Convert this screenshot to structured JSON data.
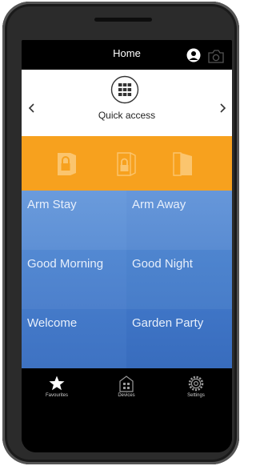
{
  "topbar": {
    "title": "Home",
    "user_icon": "user-circle-icon",
    "camera_icon": "camera-icon"
  },
  "quick_access": {
    "label": "Quick access",
    "icon": "grid-menu-icon",
    "prev_icon": "chevron-left-icon",
    "next_icon": "chevron-right-icon"
  },
  "lock_actions": [
    {
      "icon": "lock-closed-icon"
    },
    {
      "icon": "lock-partial-icon"
    },
    {
      "icon": "lock-open-icon"
    }
  ],
  "scenes": [
    {
      "label": "Arm Stay"
    },
    {
      "label": "Arm Away"
    },
    {
      "label": "Good Morning"
    },
    {
      "label": "Good Night"
    },
    {
      "label": "Welcome"
    },
    {
      "label": "Garden Party"
    }
  ],
  "bottom_nav": [
    {
      "label": "Favourites",
      "icon": "star-icon"
    },
    {
      "label": "Devices",
      "icon": "devices-icon"
    },
    {
      "label": "Settings",
      "icon": "gear-icon"
    }
  ],
  "colors": {
    "accent_orange": "#f7a11e",
    "tile_blue": "#5a8cd2",
    "bar_black": "#000000"
  }
}
